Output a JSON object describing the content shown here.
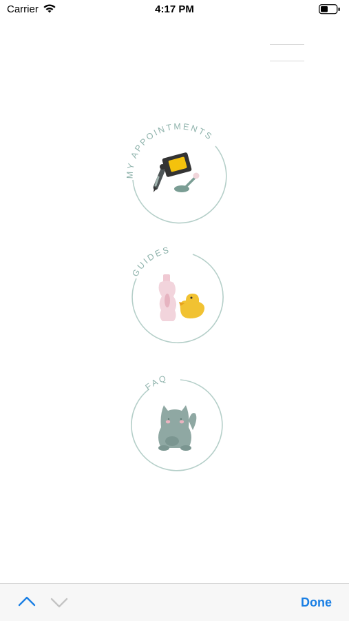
{
  "status_bar": {
    "carrier": "Carrier",
    "time": "4:17 PM",
    "icons": [
      "wifi-icon",
      "battery-icon"
    ]
  },
  "menu": {
    "icon": "hamburger-menu-icon"
  },
  "nav_items": [
    {
      "label": "MY APPOINTMENTS",
      "icon": "tattoo-machine-icon"
    },
    {
      "label": "GUIDES",
      "icon": "lotion-bottle-and-duck-icon"
    },
    {
      "label": "FAQ",
      "icon": "lucky-cat-icon"
    }
  ],
  "toolbar": {
    "previous_icon": "chevron-up-icon",
    "next_icon": "chevron-down-icon",
    "done_label": "Done"
  },
  "colors": {
    "circle_stroke": "#b5cfc9",
    "label": "#8fb3ac",
    "accent": "#1a7fe4",
    "duck": "#f1c232",
    "cat": "#8fa8a3",
    "bottle": "#f2d4dc"
  }
}
